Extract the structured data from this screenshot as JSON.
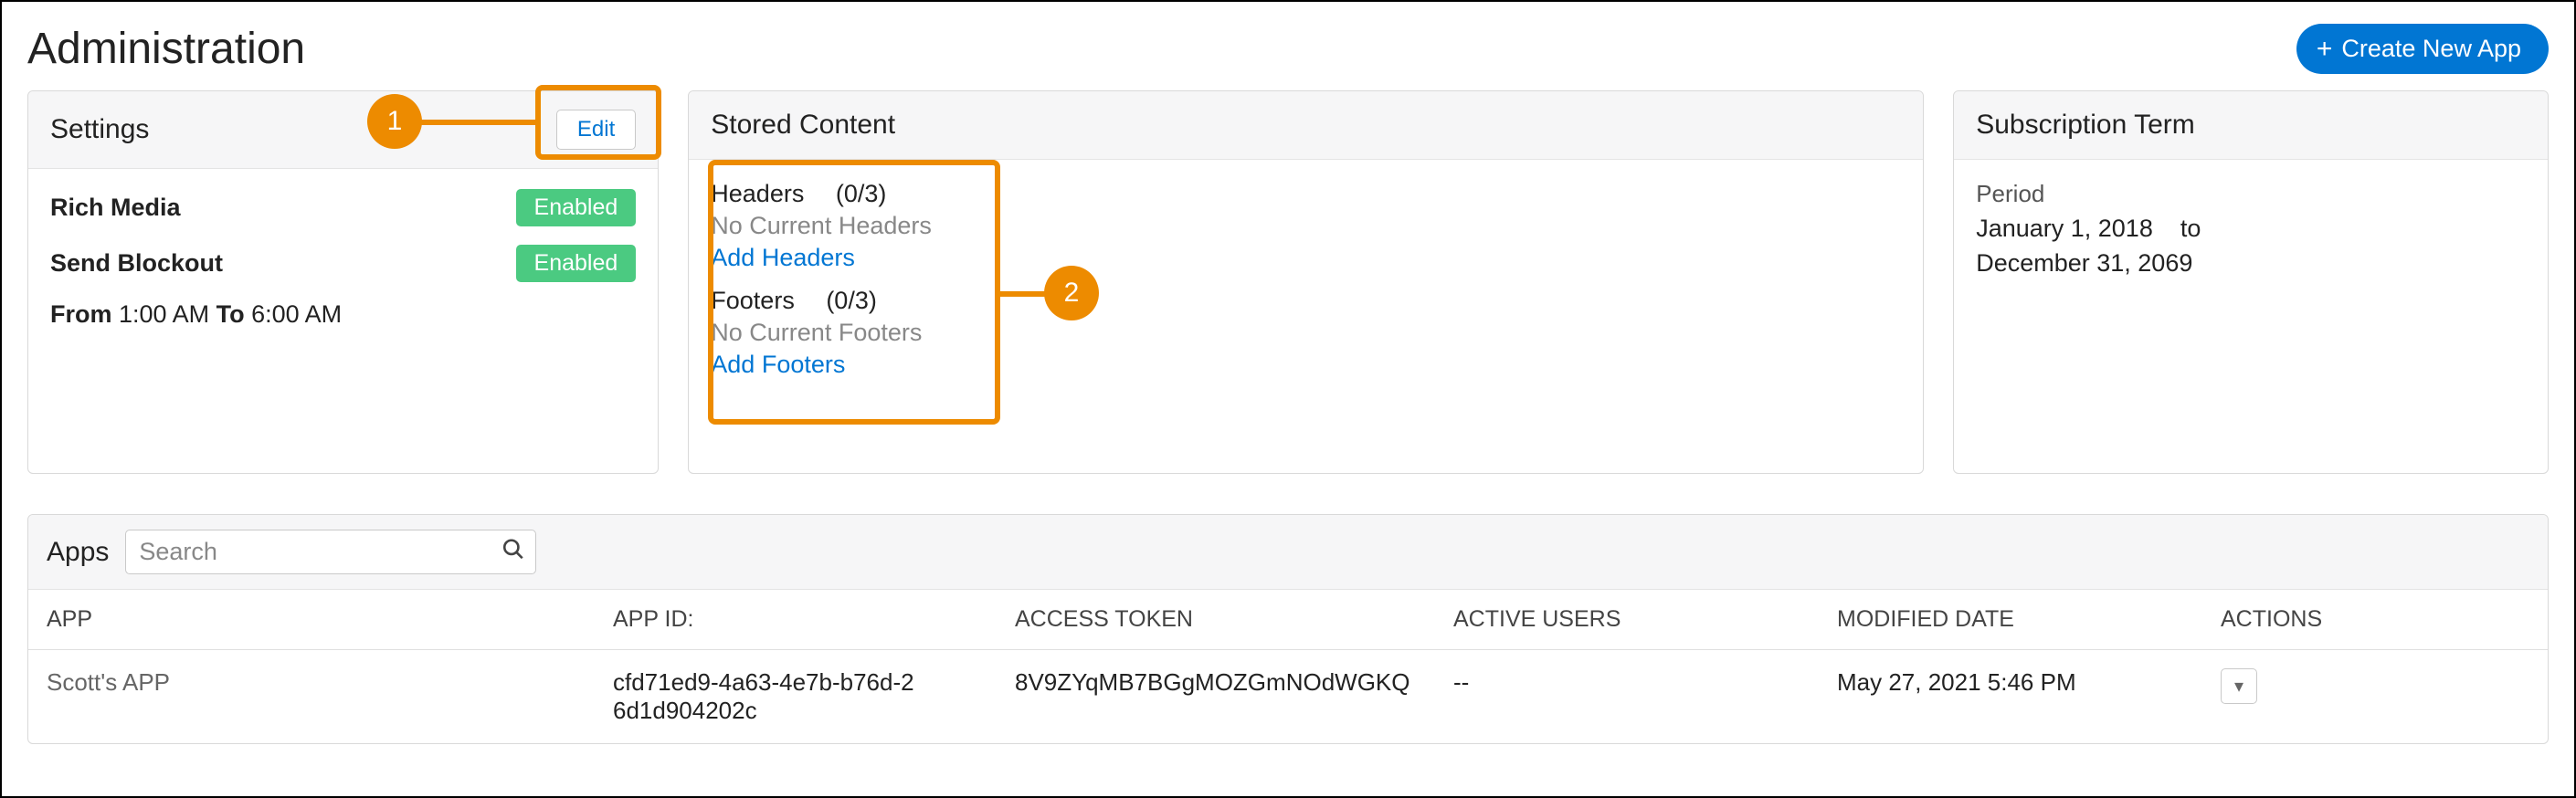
{
  "header": {
    "title": "Administration",
    "create_label": "Create New App",
    "plus_glyph": "+"
  },
  "callouts": {
    "one": "1",
    "two": "2"
  },
  "settings": {
    "title": "Settings",
    "edit_label": "Edit",
    "rich_media_label": "Rich Media",
    "rich_media_status": "Enabled",
    "send_blockout_label": "Send Blockout",
    "send_blockout_status": "Enabled",
    "from_label": "From",
    "from_value": "1:00 AM",
    "to_label": "To",
    "to_value": "6:00 AM"
  },
  "stored": {
    "title": "Stored Content",
    "headers_title": "Headers  (0/3)",
    "headers_none": "No Current Headers",
    "headers_link": "Add Headers",
    "footers_title": "Footers  (0/3)",
    "footers_none": "No Current Footers",
    "footers_link": "Add Footers"
  },
  "subscription": {
    "title": "Subscription Term",
    "period_label": "Period",
    "start": "January 1, 2018",
    "to": "to",
    "end": "December 31, 2069"
  },
  "apps": {
    "title": "Apps",
    "search_placeholder": "Search",
    "cols": {
      "app": "APP",
      "app_id": "APP ID:",
      "access_token": "ACCESS TOKEN",
      "active_users": "ACTIVE USERS",
      "modified": "MODIFIED DATE",
      "actions": "ACTIONS"
    },
    "rows": [
      {
        "app": "Scott's APP",
        "app_id": "cfd71ed9-4a63-4e7b-b76d-26d1d904202c",
        "access_token": "8V9ZYqMB7BGgMOZGmNOdWGKQ",
        "active_users": "--",
        "modified": "May 27, 2021 5:46 PM",
        "action_glyph": "▾"
      }
    ]
  }
}
